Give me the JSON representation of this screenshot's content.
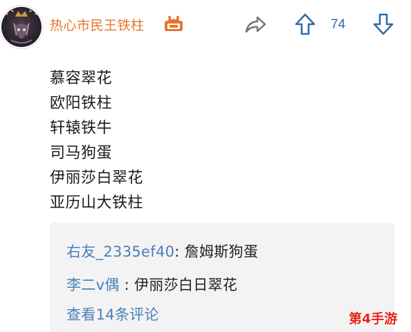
{
  "header": {
    "username": "热心市民王铁柱",
    "vote_count": "74",
    "username_color": "#e4782a",
    "vote_color": "#2d6ea8"
  },
  "icons": {
    "avatar": "avatar-icon",
    "vip_badge": "vip-crown-badge-icon",
    "share": "share-arrow-icon",
    "upvote": "upvote-arrow-icon",
    "downvote": "downvote-arrow-icon"
  },
  "post": {
    "lines": [
      "慕容翠花",
      "欧阳铁柱",
      "轩辕铁牛",
      "司马狗蛋",
      "伊丽莎白翠花",
      "亚历山大铁柱"
    ]
  },
  "comments": {
    "items": [
      {
        "author": "右友_2335ef40",
        "separator": ":",
        "text": "詹姆斯狗蛋"
      },
      {
        "author": "李二v偶",
        "separator": ":",
        "text": "伊丽莎白日翠花"
      }
    ],
    "view_more": "查看14条评论",
    "link_color": "#4a80b8",
    "box_color": "#f3f3f4"
  },
  "watermark": {
    "text": "第4手游",
    "color": "#e7231a"
  }
}
